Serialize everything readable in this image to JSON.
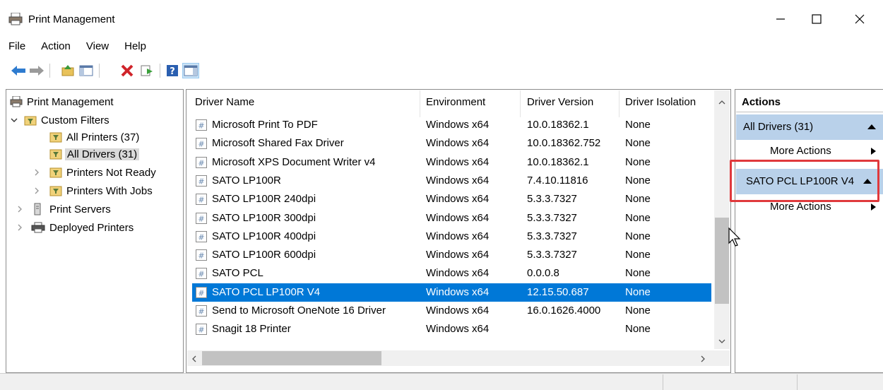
{
  "window": {
    "title": "Print Management",
    "minimize_glyph": "—",
    "maximize_glyph": "☐",
    "close_glyph": "✕"
  },
  "menu": [
    "File",
    "Action",
    "View",
    "Help"
  ],
  "toolbar": [
    "back-arrow-icon",
    "forward-arrow-icon",
    "up-folder-icon",
    "show-hide-tree-icon",
    "delete-icon",
    "export-list-icon",
    "help-icon",
    "show-hide-action-pane-icon"
  ],
  "tree": {
    "root": "Print Management",
    "custom_filters": "Custom Filters",
    "all_printers": "All Printers (37)",
    "all_drivers": "All Drivers (31)",
    "printers_not_ready": "Printers Not Ready",
    "printers_with_jobs": "Printers With Jobs",
    "print_servers": "Print Servers",
    "deployed_printers": "Deployed Printers"
  },
  "columns": {
    "name": "Driver Name",
    "environment": "Environment",
    "version": "Driver Version",
    "isolation": "Driver Isolation"
  },
  "drivers": [
    {
      "name": "Microsoft Print To PDF",
      "env": "Windows x64",
      "version": "10.0.18362.1",
      "isolation": "None"
    },
    {
      "name": "Microsoft Shared Fax Driver",
      "env": "Windows x64",
      "version": "10.0.18362.752",
      "isolation": "None"
    },
    {
      "name": "Microsoft XPS Document Writer v4",
      "env": "Windows x64",
      "version": "10.0.18362.1",
      "isolation": "None"
    },
    {
      "name": "SATO LP100R",
      "env": "Windows x64",
      "version": "7.4.10.11816",
      "isolation": "None"
    },
    {
      "name": "SATO LP100R 240dpi",
      "env": "Windows x64",
      "version": "5.3.3.7327",
      "isolation": "None"
    },
    {
      "name": "SATO LP100R 300dpi",
      "env": "Windows x64",
      "version": "5.3.3.7327",
      "isolation": "None"
    },
    {
      "name": "SATO LP100R 400dpi",
      "env": "Windows x64",
      "version": "5.3.3.7327",
      "isolation": "None"
    },
    {
      "name": "SATO LP100R 600dpi",
      "env": "Windows x64",
      "version": "5.3.3.7327",
      "isolation": "None"
    },
    {
      "name": "SATO PCL",
      "env": "Windows x64",
      "version": "0.0.0.8",
      "isolation": "None"
    },
    {
      "name": "SATO PCL LP100R V4",
      "env": "Windows x64",
      "version": "12.15.50.687",
      "isolation": "None"
    },
    {
      "name": "Send to Microsoft OneNote 16 Driver",
      "env": "Windows x64",
      "version": "16.0.1626.4000",
      "isolation": "None"
    },
    {
      "name": "Snagit 18 Printer",
      "env": "Windows x64",
      "version": "",
      "isolation": "None"
    }
  ],
  "selected_driver": "SATO PCL LP100R V4",
  "actions": {
    "title": "Actions",
    "section1": "All Drivers (31)",
    "more1": "More Actions",
    "section2": "SATO PCL LP100R V4",
    "more2": "More Actions"
  },
  "colors": {
    "selection": "#0078d7",
    "action_section": "#b9d1ea",
    "highlight_box": "#e0393c"
  }
}
